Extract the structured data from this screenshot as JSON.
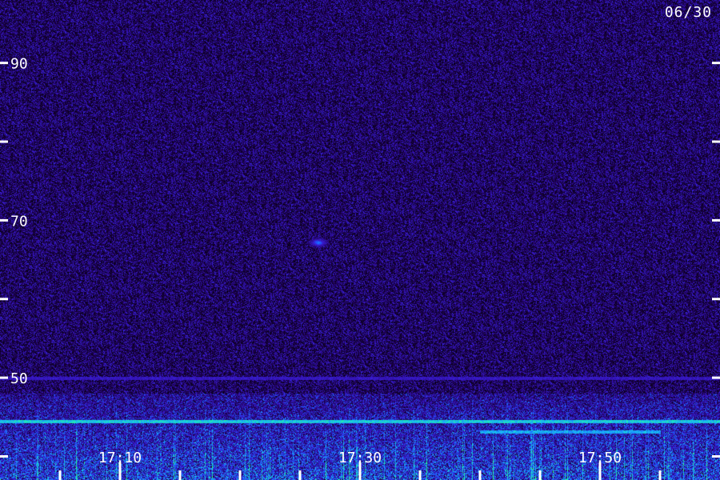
{
  "chart_data": {
    "type": "heatmap",
    "title": "06/30",
    "xlabel": "",
    "ylabel": "",
    "x_ticks": [
      {
        "label": "17:10",
        "value": 10
      },
      {
        "label": "17:30",
        "value": 30
      },
      {
        "label": "17:50",
        "value": 50
      }
    ],
    "x_minor_ticks": [
      5,
      10,
      15,
      20,
      25,
      30,
      35,
      40,
      45,
      50,
      55
    ],
    "xlim": [
      0,
      60
    ],
    "y_ticks": [
      {
        "label": "90",
        "value": 90
      },
      {
        "label": "70",
        "value": 70
      },
      {
        "label": "50",
        "value": 50
      }
    ],
    "y_minor_ticks": [
      100,
      80,
      60,
      40
    ],
    "ylim": [
      37,
      98
    ],
    "colormap": [
      "#000000",
      "#180040",
      "#2a0a8c",
      "#3a1ad0",
      "#1a5cff",
      "#1aa8ff",
      "#18e0d0",
      "#30ff80"
    ],
    "bands": [
      {
        "y": 50,
        "intensity": 0.45,
        "type": "line"
      },
      {
        "y": 44.5,
        "intensity": 0.95,
        "type": "line",
        "x_from": 0,
        "x_to": 60
      },
      {
        "y": 43.2,
        "intensity": 0.85,
        "type": "line",
        "x_from": 40,
        "x_to": 55
      },
      {
        "y_from": 37,
        "y_to": 48,
        "intensity": 0.55,
        "type": "region"
      }
    ],
    "spots": [
      {
        "x": 26.5,
        "y": 67.2,
        "intensity": 0.6
      }
    ]
  }
}
